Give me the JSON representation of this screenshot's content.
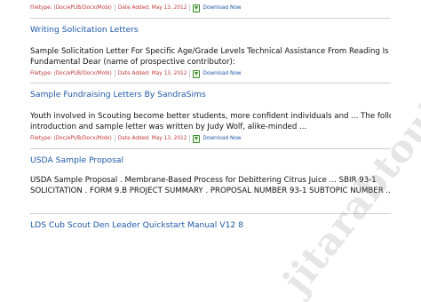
{
  "entries": [
    {
      "title": "",
      "desc_line1": "",
      "desc_line2": "",
      "filetype": "Filetype: (Doc/ePUB/Docx/Mobi)",
      "date": "Date Added: May 13, 2012",
      "download": "Download Now"
    },
    {
      "title": "Writing Solicitation Letters",
      "desc_line1": "Sample Solicitation Letter For Specific Age/Grade Levels Technical Assistance From Reading Is",
      "desc_line2": "Fundamental Dear (name of prospective contributor):",
      "filetype": "Filetype: (Doc/ePUB/Docx/Mobi)",
      "date": "Date Added: May 13, 2012",
      "download": "Download Now"
    },
    {
      "title": "Sample Fundraising Letters By SandraSims",
      "desc_line1": "Youth involved in Scouting become better students, more confident individuals and ... The following",
      "desc_line2": "introduction and sample letter was written by Judy Wolf, alike-minded ...",
      "filetype": "Filetype: (Doc/ePUB/Docx/Mobi)",
      "date": "Date Added: May 13, 2012",
      "download": "Download Now"
    },
    {
      "title": "USDA Sample Proposal",
      "desc_line1": "USDA Sample Proposal . Membrane-Based Process for Debittering Citrus Juice ... SBIR 93-1",
      "desc_line2": "SOLICITATION . FORM 9.B PROJECT SUMMARY . PROPOSAL NUMBER 93-1 SUBTOPIC NUMBER ...",
      "filetype": "",
      "date": "",
      "download": ""
    },
    {
      "title": "LDS Cub Scout Den Leader Quickstart Manual V12 8",
      "desc_line1": "",
      "desc_line2": "",
      "filetype": "",
      "date": "",
      "download": ""
    }
  ],
  "watermark": "jitarabtoutz.com",
  "colors": {
    "link": "#1f58a8",
    "meta": "#c23a3a",
    "download_icon": "#3e8a2e",
    "divider": "#cfcfcf"
  },
  "icons": {
    "download": "download-icon"
  }
}
